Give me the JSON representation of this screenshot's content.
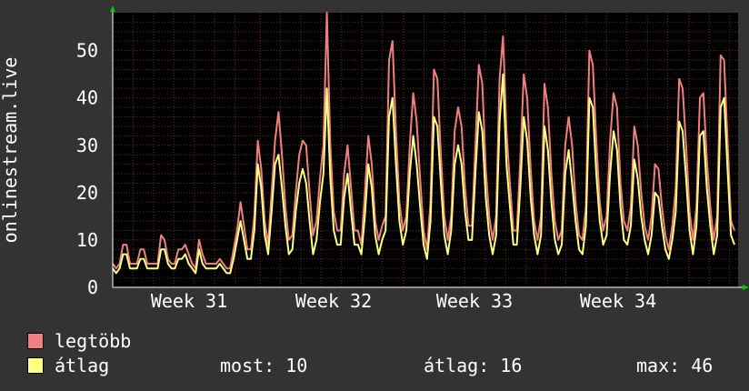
{
  "chart_data": {
    "type": "line",
    "ylabel": "onlinestream.live",
    "ylim": [
      0,
      58
    ],
    "yticks": [
      0,
      10,
      20,
      30,
      40,
      50
    ],
    "xlabels": [
      "Week 31",
      "Week 32",
      "Week 33",
      "Week 34"
    ],
    "grid": true,
    "legend_placement": "bottom-left",
    "colors": {
      "background": "#333333",
      "plot": "#000000",
      "grid_major": "#8b2020",
      "grid_minor": "#5a2a2a",
      "axis": "#ffffff"
    },
    "series": [
      {
        "name": "legtöbb",
        "color": "#f08080",
        "values": [
          5,
          4,
          5,
          9,
          9,
          5,
          5,
          5,
          8,
          8,
          5,
          5,
          5,
          5,
          11,
          10,
          6,
          5,
          5,
          8,
          8,
          9,
          7,
          5,
          4,
          10,
          7,
          5,
          5,
          5,
          5,
          6,
          5,
          4,
          4,
          8,
          12,
          18,
          13,
          8,
          8,
          15,
          31,
          25,
          14,
          9,
          20,
          31,
          37,
          28,
          17,
          10,
          11,
          20,
          28,
          31,
          30,
          20,
          11,
          14,
          23,
          30,
          58,
          30,
          16,
          12,
          12,
          24,
          30,
          21,
          12,
          12,
          9,
          20,
          32,
          26,
          14,
          10,
          13,
          15,
          48,
          52,
          33,
          18,
          12,
          15,
          30,
          41,
          35,
          23,
          12,
          8,
          18,
          46,
          44,
          28,
          15,
          10,
          15,
          33,
          38,
          34,
          21,
          13,
          13,
          30,
          47,
          43,
          25,
          15,
          10,
          15,
          44,
          53,
          33,
          22,
          12,
          12,
          27,
          45,
          40,
          25,
          14,
          10,
          15,
          43,
          38,
          24,
          14,
          10,
          12,
          30,
          36,
          30,
          18,
          11,
          10,
          17,
          50,
          47,
          31,
          18,
          12,
          15,
          31,
          41,
          38,
          22,
          14,
          12,
          17,
          34,
          30,
          20,
          13,
          10,
          15,
          26,
          25,
          17,
          11,
          8,
          13,
          21,
          44,
          42,
          30,
          16,
          10,
          17,
          40,
          41,
          27,
          17,
          10,
          15,
          49,
          48,
          31,
          14,
          12
        ]
      },
      {
        "name": "átlag",
        "color": "#ffff80",
        "values": [
          4,
          3,
          4,
          7,
          7,
          4,
          4,
          4,
          6,
          6,
          4,
          4,
          4,
          4,
          8,
          8,
          5,
          4,
          4,
          6,
          6,
          7,
          5,
          4,
          3,
          8,
          5,
          4,
          4,
          4,
          4,
          5,
          4,
          3,
          3,
          6,
          10,
          14,
          10,
          6,
          6,
          12,
          26,
          21,
          11,
          7,
          16,
          26,
          28,
          21,
          13,
          7,
          8,
          16,
          22,
          25,
          22,
          14,
          7,
          10,
          18,
          24,
          42,
          23,
          12,
          9,
          9,
          19,
          24,
          16,
          9,
          9,
          7,
          15,
          26,
          21,
          11,
          7,
          10,
          12,
          36,
          40,
          26,
          14,
          9,
          12,
          24,
          32,
          26,
          17,
          9,
          6,
          14,
          36,
          34,
          22,
          11,
          7,
          12,
          26,
          30,
          26,
          16,
          10,
          10,
          24,
          37,
          33,
          19,
          11,
          7,
          11,
          35,
          45,
          26,
          17,
          9,
          9,
          21,
          36,
          31,
          19,
          11,
          7,
          11,
          34,
          29,
          18,
          10,
          7,
          9,
          24,
          29,
          22,
          14,
          8,
          7,
          13,
          40,
          38,
          24,
          14,
          9,
          11,
          24,
          33,
          29,
          17,
          10,
          9,
          13,
          27,
          23,
          15,
          10,
          7,
          11,
          20,
          19,
          13,
          8,
          6,
          10,
          16,
          35,
          33,
          23,
          12,
          7,
          13,
          32,
          33,
          21,
          13,
          7,
          11,
          38,
          40,
          25,
          11,
          9
        ]
      }
    ]
  },
  "legend": [
    {
      "label": "legtöbb",
      "color": "#f08080"
    },
    {
      "label": "átlag",
      "color": "#ffff80"
    }
  ],
  "stats": {
    "most": "most: 10",
    "atlag": "átlag: 16",
    "max": "max: 46"
  }
}
